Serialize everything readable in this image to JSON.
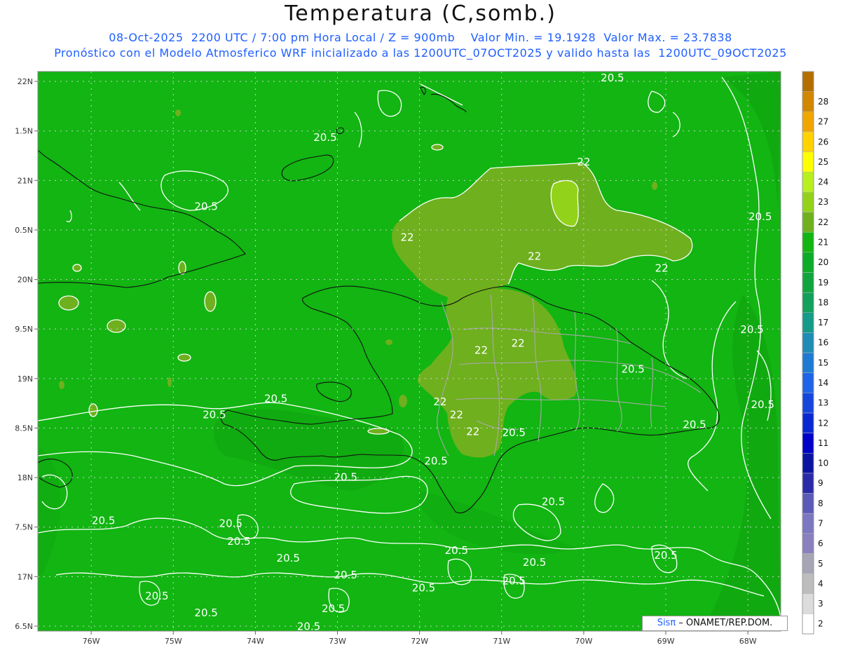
{
  "title": "Temperatura (C,somb.)",
  "subtitle_line1": "08-Oct-2025  2200 UTC / 7:00 pm Hora Local / Z = 900mb    Valor Min. = 19.1928  Valor Max. = 23.7838",
  "subtitle_line2": "Pronóstico con el Modelo Atmosferico WRF inicializado a las 1200UTC_07OCT2025 y valido hasta las  1200UTC_09OCT2025",
  "credit": {
    "logo": "Sisπ",
    "text": " – ONAMET/REP.DOM."
  },
  "colors": {
    "field_base": "#12b512",
    "field_dark": "#0fa00f",
    "field_22": "#6fb01e",
    "field_23": "#93d21a",
    "contour": "#ffffff",
    "coast": "#111111",
    "province": "#a8a8a8",
    "grid": "#d0d0d0"
  },
  "map": {
    "lon_range": [
      -76.65,
      -67.6
    ],
    "lat_range": [
      16.45,
      22.1
    ],
    "lon_ticks": [
      {
        "v": -76,
        "label": "76W"
      },
      {
        "v": -75,
        "label": "75W"
      },
      {
        "v": -74,
        "label": "74W"
      },
      {
        "v": -73,
        "label": "73W"
      },
      {
        "v": -72,
        "label": "72W"
      },
      {
        "v": -71,
        "label": "71W"
      },
      {
        "v": -70,
        "label": "70W"
      },
      {
        "v": -69,
        "label": "69W"
      },
      {
        "v": -68,
        "label": "68W"
      }
    ],
    "lat_ticks": [
      {
        "v": 22,
        "label": "22N"
      },
      {
        "v": 21.5,
        "label": "1.5N"
      },
      {
        "v": 21,
        "label": "21N"
      },
      {
        "v": 20.5,
        "label": "0.5N"
      },
      {
        "v": 20,
        "label": "20N"
      },
      {
        "v": 19.5,
        "label": "9.5N"
      },
      {
        "v": 19,
        "label": "19N"
      },
      {
        "v": 18.5,
        "label": "8.5N"
      },
      {
        "v": 18,
        "label": "18N"
      },
      {
        "v": 17.5,
        "label": "7.5N"
      },
      {
        "v": 17,
        "label": "17N"
      },
      {
        "v": 16.5,
        "label": "6.5N"
      }
    ],
    "contour_labels": [
      {
        "text": "20.5",
        "lon": -69.65,
        "lat": 22.0
      },
      {
        "text": "20.5",
        "lon": -73.15,
        "lat": 21.4
      },
      {
        "text": "22",
        "lon": -70.0,
        "lat": 21.15
      },
      {
        "text": "20.5",
        "lon": -74.6,
        "lat": 20.7
      },
      {
        "text": "22",
        "lon": -72.15,
        "lat": 20.39
      },
      {
        "text": "22",
        "lon": -70.6,
        "lat": 20.2
      },
      {
        "text": "22",
        "lon": -69.05,
        "lat": 20.08
      },
      {
        "text": "20.5",
        "lon": -67.85,
        "lat": 20.6
      },
      {
        "text": "20.5",
        "lon": -67.95,
        "lat": 19.46
      },
      {
        "text": "22",
        "lon": -71.25,
        "lat": 19.25
      },
      {
        "text": "22",
        "lon": -70.8,
        "lat": 19.32
      },
      {
        "text": "20.5",
        "lon": -69.4,
        "lat": 19.06
      },
      {
        "text": "20.5",
        "lon": -73.75,
        "lat": 18.76
      },
      {
        "text": "20.5",
        "lon": -74.5,
        "lat": 18.6
      },
      {
        "text": "22",
        "lon": -71.75,
        "lat": 18.73
      },
      {
        "text": "22",
        "lon": -71.55,
        "lat": 18.6
      },
      {
        "text": "22",
        "lon": -71.35,
        "lat": 18.43
      },
      {
        "text": "20.5",
        "lon": -70.85,
        "lat": 18.42
      },
      {
        "text": "20.5",
        "lon": -68.65,
        "lat": 18.5
      },
      {
        "text": "20.5",
        "lon": -67.82,
        "lat": 18.7
      },
      {
        "text": "20.5",
        "lon": -71.8,
        "lat": 18.13
      },
      {
        "text": "20.5",
        "lon": -72.9,
        "lat": 17.97
      },
      {
        "text": "20.5",
        "lon": -70.37,
        "lat": 17.72
      },
      {
        "text": "20.5",
        "lon": -75.85,
        "lat": 17.53
      },
      {
        "text": "20.5",
        "lon": -74.3,
        "lat": 17.5
      },
      {
        "text": "20.5",
        "lon": -74.2,
        "lat": 17.32
      },
      {
        "text": "20.5",
        "lon": -73.6,
        "lat": 17.15
      },
      {
        "text": "20.5",
        "lon": -71.55,
        "lat": 17.23
      },
      {
        "text": "20.5",
        "lon": -70.6,
        "lat": 17.11
      },
      {
        "text": "20.5",
        "lon": -69.0,
        "lat": 17.18
      },
      {
        "text": "20.5",
        "lon": -72.9,
        "lat": 16.98
      },
      {
        "text": "20.5",
        "lon": -70.85,
        "lat": 16.92
      },
      {
        "text": "20.5",
        "lon": -71.95,
        "lat": 16.85
      },
      {
        "text": "20.5",
        "lon": -75.2,
        "lat": 16.77
      },
      {
        "text": "20.5",
        "lon": -73.05,
        "lat": 16.64
      },
      {
        "text": "20.5",
        "lon": -74.6,
        "lat": 16.6
      },
      {
        "text": "20.5",
        "lon": -73.35,
        "lat": 16.46
      }
    ]
  },
  "colorbar": {
    "levels": [
      {
        "label": "2",
        "color": "#ffffff"
      },
      {
        "label": "3",
        "color": "#dcdcdc"
      },
      {
        "label": "4",
        "color": "#bdbdbd"
      },
      {
        "label": "5",
        "color": "#a5a5b5"
      },
      {
        "label": "6",
        "color": "#8a7fbf"
      },
      {
        "label": "7",
        "color": "#7b77c0"
      },
      {
        "label": "8",
        "color": "#5a5ab8"
      },
      {
        "label": "9",
        "color": "#2a2aa8"
      },
      {
        "label": "10",
        "color": "#0a14a0"
      },
      {
        "label": "11",
        "color": "#0000c8"
      },
      {
        "label": "12",
        "color": "#0a28d2"
      },
      {
        "label": "13",
        "color": "#1446dc"
      },
      {
        "label": "14",
        "color": "#1e64e6"
      },
      {
        "label": "15",
        "color": "#1e7ad2"
      },
      {
        "label": "16",
        "color": "#1e8cb4"
      },
      {
        "label": "17",
        "color": "#169a8a"
      },
      {
        "label": "18",
        "color": "#12a05a"
      },
      {
        "label": "19",
        "color": "#0fa53c"
      },
      {
        "label": "20",
        "color": "#0cab28"
      },
      {
        "label": "21",
        "color": "#12b512"
      },
      {
        "label": "22",
        "color": "#6fb01e"
      },
      {
        "label": "23",
        "color": "#93d21a"
      },
      {
        "label": "24",
        "color": "#b8f01e"
      },
      {
        "label": "25",
        "color": "#ffff00"
      },
      {
        "label": "26",
        "color": "#ffd200"
      },
      {
        "label": "27",
        "color": "#f0a500"
      },
      {
        "label": "28",
        "color": "#d28700"
      },
      {
        "label": "",
        "color": "#b46e00"
      }
    ]
  }
}
